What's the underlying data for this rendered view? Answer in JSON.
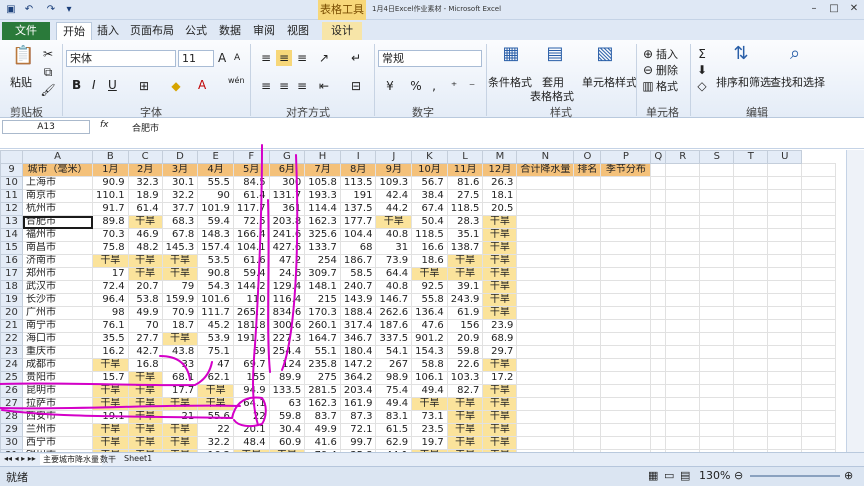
{
  "window": {
    "title": "1月4日Excel作业素材 - Microsoft Excel",
    "tool_tab": "表格工具"
  },
  "tabs": [
    "文件",
    "开始",
    "插入",
    "页面布局",
    "公式",
    "数据",
    "审阅",
    "视图",
    "设计"
  ],
  "ribbon": {
    "clipboard": {
      "paste": "粘贴",
      "group": "剪贴板"
    },
    "font": {
      "name": "宋体",
      "size": "11",
      "grow": "A",
      "shrink": "A",
      "bold": "B",
      "italic": "I",
      "underline": "U",
      "color_char": "A",
      "wen": "wén",
      "group": "字体"
    },
    "align": {
      "group": "对齐方式"
    },
    "number": {
      "format": "常规",
      "group": "数字"
    },
    "styles": {
      "cond": "条件格式",
      "table1": "套用",
      "table2": "表格格式",
      "cell": "单元格样式",
      "group": "样式"
    },
    "cells": {
      "insert": "插入",
      "delete": "删除",
      "format": "格式",
      "group": "单元格"
    },
    "edit": {
      "sort": "排序和筛选",
      "find": "查找和选择",
      "group": "编辑"
    }
  },
  "formula_bar": {
    "name_box": "A13",
    "fx": "fx",
    "value": "合肥市"
  },
  "columns": [
    "",
    "A",
    "B",
    "C",
    "D",
    "E",
    "F",
    "G",
    "H",
    "I",
    "J",
    "K",
    "L",
    "M",
    "N",
    "O",
    "P",
    "Q",
    "R",
    "S",
    "T",
    "U"
  ],
  "header_row": [
    "城市（毫米）",
    "1月",
    "2月",
    "3月",
    "4月",
    "5月",
    "6月",
    "7月",
    "8月",
    "9月",
    "10月",
    "11月",
    "12月",
    "合计降水量",
    "排名",
    "季节分布"
  ],
  "rows": [
    {
      "n": "10",
      "cells": [
        "上海市",
        "90.9",
        "32.3",
        "30.1",
        "55.5",
        "84.5",
        "300",
        "105.8",
        "113.5",
        "109.3",
        "56.7",
        "81.6",
        "26.3"
      ]
    },
    {
      "n": "11",
      "cells": [
        "南京市",
        "110.1",
        "18.9",
        "32.2",
        "90",
        "61.4",
        "131.7",
        "193.3",
        "191",
        "42.4",
        "38.4",
        "27.5",
        "18.1"
      ]
    },
    {
      "n": "12",
      "cells": [
        "杭州市",
        "91.7",
        "61.4",
        "37.7",
        "101.9",
        "117.7",
        "361",
        "114.4",
        "137.5",
        "44.2",
        "67.4",
        "118.5",
        "20.5"
      ]
    },
    {
      "n": "13",
      "cells": [
        "合肥市",
        "89.8",
        "干旱",
        "68.3",
        "59.4",
        "72.5",
        "203.8",
        "162.3",
        "177.7",
        "干旱",
        "50.4",
        "28.3",
        "干旱"
      ]
    },
    {
      "n": "14",
      "cells": [
        "福州市",
        "70.3",
        "46.9",
        "67.8",
        "148.3",
        "166.4",
        "241.6",
        "325.6",
        "104.4",
        "40.8",
        "118.5",
        "35.1",
        "干旱"
      ]
    },
    {
      "n": "15",
      "cells": [
        "南昌市",
        "75.8",
        "48.2",
        "145.3",
        "157.4",
        "104.1",
        "427.6",
        "133.7",
        "68",
        "31",
        "16.6",
        "138.7",
        "干旱"
      ]
    },
    {
      "n": "16",
      "cells": [
        "济南市",
        "干旱",
        "干旱",
        "干旱",
        "53.5",
        "61.6",
        "47.2",
        "254",
        "186.7",
        "73.9",
        "18.6",
        "干旱",
        "干旱"
      ]
    },
    {
      "n": "17",
      "cells": [
        "郑州市",
        "17",
        "干旱",
        "干旱",
        "90.8",
        "59.4",
        "24.6",
        "309.7",
        "58.5",
        "64.4",
        "干旱",
        "干旱",
        "干旱"
      ]
    },
    {
      "n": "18",
      "cells": [
        "武汉市",
        "72.4",
        "20.7",
        "79",
        "54.3",
        "144.2",
        "129.4",
        "148.1",
        "240.7",
        "40.8",
        "92.5",
        "39.1",
        "干旱"
      ]
    },
    {
      "n": "19",
      "cells": [
        "长沙市",
        "96.4",
        "53.8",
        "159.9",
        "101.6",
        "110",
        "116.4",
        "215",
        "143.9",
        "146.7",
        "55.8",
        "243.9",
        "干旱"
      ]
    },
    {
      "n": "20",
      "cells": [
        "广州市",
        "98",
        "49.9",
        "70.9",
        "111.7",
        "265.2",
        "834.6",
        "170.3",
        "188.4",
        "262.6",
        "136.4",
        "61.9",
        "干旱"
      ]
    },
    {
      "n": "21",
      "cells": [
        "南宁市",
        "76.1",
        "70",
        "18.7",
        "45.2",
        "181.8",
        "300.6",
        "260.1",
        "317.4",
        "187.6",
        "47.6",
        "156",
        "23.9"
      ]
    },
    {
      "n": "22",
      "cells": [
        "海口市",
        "35.5",
        "27.7",
        "干旱",
        "53.9",
        "191.3",
        "227.3",
        "164.7",
        "346.7",
        "337.5",
        "901.2",
        "20.9",
        "68.9"
      ]
    },
    {
      "n": "23",
      "cells": [
        "重庆市",
        "16.2",
        "42.7",
        "43.8",
        "75.1",
        "69",
        "254.4",
        "55.1",
        "180.4",
        "54.1",
        "154.3",
        "59.8",
        "29.7"
      ]
    },
    {
      "n": "24",
      "cells": [
        "成都市",
        "干旱",
        "16.8",
        "33",
        "47",
        "69.7",
        "124",
        "235.8",
        "147.2",
        "267",
        "58.8",
        "22.6",
        "干旱"
      ]
    },
    {
      "n": "25",
      "cells": [
        "贵阳市",
        "15.7",
        "干旱",
        "68.1",
        "62.1",
        "155",
        "89.9",
        "275",
        "364.2",
        "98.9",
        "106.1",
        "103.3",
        "17.2"
      ]
    },
    {
      "n": "26",
      "cells": [
        "昆明市",
        "干旱",
        "干旱",
        "17.7",
        "干旱",
        "94.9",
        "133.5",
        "281.5",
        "203.4",
        "75.4",
        "49.4",
        "82.7",
        "干旱"
      ]
    },
    {
      "n": "27",
      "cells": [
        "拉萨市",
        "干旱",
        "干旱",
        "干旱",
        "干旱",
        "64.1",
        "63",
        "162.3",
        "161.9",
        "49.4",
        "干旱",
        "干旱",
        "干旱"
      ]
    },
    {
      "n": "28",
      "cells": [
        "西安市",
        "19.1",
        "干旱",
        "21",
        "55.6",
        "22",
        "59.8",
        "83.7",
        "87.3",
        "83.1",
        "73.1",
        "干旱",
        "干旱"
      ]
    },
    {
      "n": "29",
      "cells": [
        "兰州市",
        "干旱",
        "干旱",
        "干旱",
        "22",
        "20.1",
        "30.4",
        "49.9",
        "72.1",
        "61.5",
        "23.5",
        "干旱",
        "干旱"
      ]
    },
    {
      "n": "30",
      "cells": [
        "西宁市",
        "干旱",
        "干旱",
        "干旱",
        "32.2",
        "48.4",
        "60.9",
        "41.6",
        "99.7",
        "62.9",
        "19.7",
        "干旱",
        "干旱"
      ]
    },
    {
      "n": "31",
      "cells": [
        "银川市",
        "干旱",
        "干旱",
        "干旱",
        "16.3",
        "干旱",
        "干旱",
        "79.4",
        "35.8",
        "44.1",
        "干旱",
        "干旱",
        "干旱"
      ]
    },
    {
      "n": "32",
      "cells": [
        "乌鲁木齐市",
        "干旱",
        "干旱",
        "17.8",
        "21.7",
        "15.8",
        "干旱",
        "20.9",
        "17.1",
        "16.8",
        "干旱",
        "干旱",
        "干旱"
      ]
    }
  ],
  "sheet_tabs": [
    "主要城市降水量",
    "数干",
    "Sheet1"
  ],
  "status": {
    "ready": "就绪",
    "zoom": "130%"
  }
}
